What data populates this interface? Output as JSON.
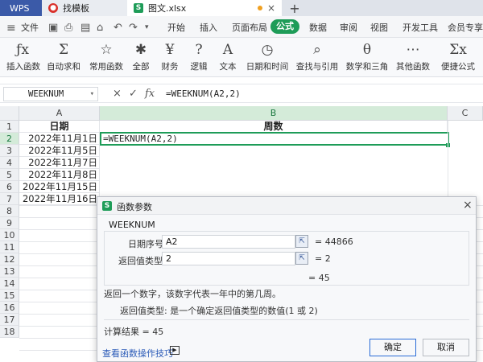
{
  "titlebar": {
    "tabs": [
      {
        "label": "WPS"
      },
      {
        "label": "找模板"
      },
      {
        "label": "图文.xlsx"
      }
    ]
  },
  "menubar": {
    "file": "文件",
    "items": [
      "开始",
      "插入",
      "页面布局",
      "公式",
      "数据",
      "审阅",
      "视图",
      "开发工具",
      "会员专享"
    ],
    "active": "公式"
  },
  "ribbon": {
    "buttons": [
      {
        "icon": "fx-icon",
        "glyph": "ƒx",
        "label": "插入函数"
      },
      {
        "icon": "sum-icon",
        "glyph": "Σ",
        "label": "自动求和"
      },
      {
        "icon": "star-icon",
        "glyph": "☆",
        "label": "常用函数"
      },
      {
        "icon": "all-icon",
        "glyph": "✱",
        "label": "全部"
      },
      {
        "icon": "finance-icon",
        "glyph": "¥",
        "label": "财务"
      },
      {
        "icon": "logic-icon",
        "glyph": "?",
        "label": "逻辑"
      },
      {
        "icon": "text-icon",
        "glyph": "A",
        "label": "文本"
      },
      {
        "icon": "datetime-icon",
        "glyph": "◷",
        "label": "日期和时间"
      },
      {
        "icon": "lookup-icon",
        "glyph": "⌕",
        "label": "查找与引用"
      },
      {
        "icon": "math-icon",
        "glyph": "θ",
        "label": "数学和三角"
      },
      {
        "icon": "more-icon",
        "glyph": "⋯",
        "label": "其他函数"
      },
      {
        "icon": "quick-formula-icon",
        "glyph": "Σx",
        "label": "便捷公式"
      }
    ]
  },
  "formula_bar": {
    "name_box": "WEEKNUM",
    "formula": "=WEEKNUM(A2,2)"
  },
  "sheet": {
    "columns": [
      "A",
      "B",
      "C"
    ],
    "rows": [
      "1",
      "2",
      "3",
      "4",
      "5",
      "6",
      "7",
      "8",
      "9",
      "10",
      "11",
      "12",
      "13",
      "14",
      "15",
      "16",
      "17",
      "18"
    ],
    "header_a": "日期",
    "header_b": "周数",
    "dates": [
      "2022年11月1日",
      "2022年11月5日",
      "2022年11月7日",
      "2022年11月8日",
      "2022年11月15日",
      "2022年11月16日"
    ],
    "b2_formula": "=WEEKNUM(A2,2)"
  },
  "dialog": {
    "title": "函数参数",
    "function_name": "WEEKNUM",
    "arg1_label": "日期序号",
    "arg1_value": "A2",
    "arg1_result": "= 44866",
    "arg2_label": "返回值类型",
    "arg2_value": "2",
    "arg2_result": "= 2",
    "total_result": "= 45",
    "description": "返回一个数字，该数字代表一年中的第几周。",
    "param_help": "返回值类型:  是一个确定返回值类型的数值(1 或 2)",
    "calc_result": "计算结果 =  45",
    "help_link": "查看函数操作技巧",
    "ok_label": "确定",
    "cancel_label": "取消"
  },
  "colors": {
    "accent_green": "#1e9c58",
    "wps_blue": "#3b5aa8",
    "link_blue": "#2a5ab7"
  }
}
